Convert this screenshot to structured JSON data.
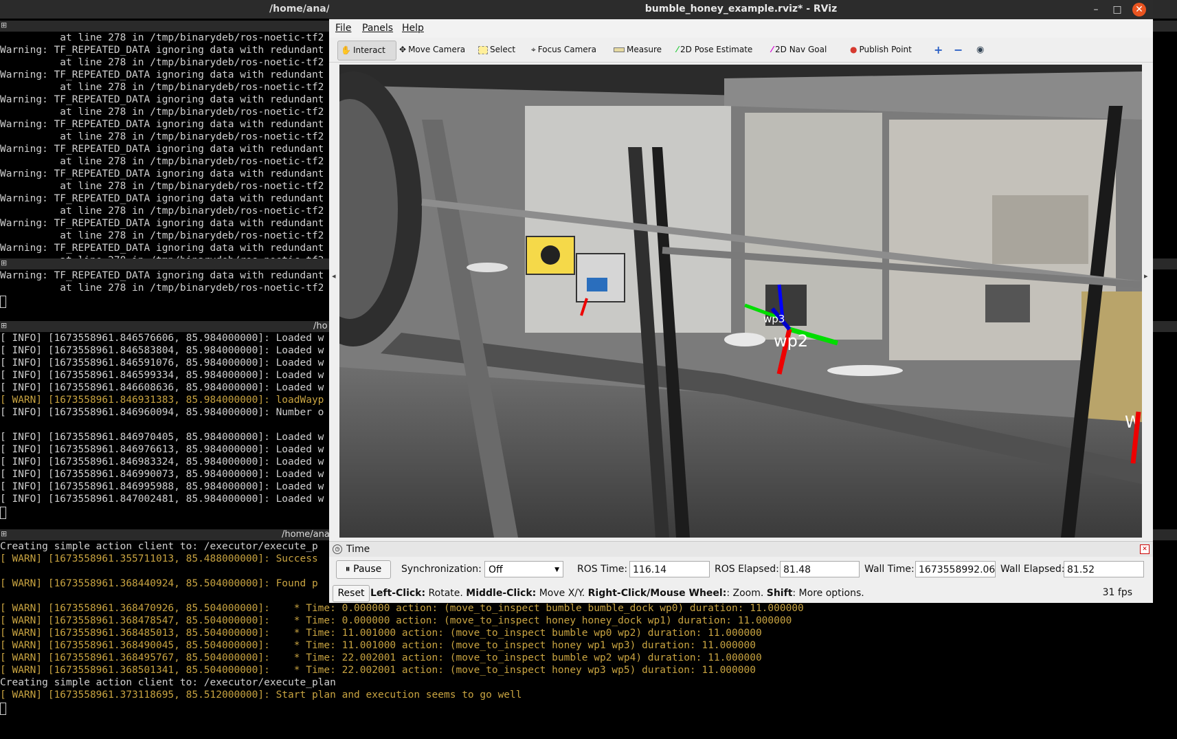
{
  "terminal": {
    "window_title": "/home/ana/",
    "pane1": {
      "lines": [
        {
          "text": "          at line 278 in /tmp/binarydeb/ros-noetic-tf2",
          "level": "plain"
        },
        {
          "text": "Warning: TF_REPEATED_DATA ignoring data with redundant",
          "level": "plain"
        },
        {
          "text": "          at line 278 in /tmp/binarydeb/ros-noetic-tf2",
          "level": "plain"
        },
        {
          "text": "Warning: TF_REPEATED_DATA ignoring data with redundant",
          "level": "plain"
        },
        {
          "text": "          at line 278 in /tmp/binarydeb/ros-noetic-tf2",
          "level": "plain"
        },
        {
          "text": "Warning: TF_REPEATED_DATA ignoring data with redundant",
          "level": "plain"
        },
        {
          "text": "          at line 278 in /tmp/binarydeb/ros-noetic-tf2",
          "level": "plain"
        },
        {
          "text": "Warning: TF_REPEATED_DATA ignoring data with redundant",
          "level": "plain"
        },
        {
          "text": "          at line 278 in /tmp/binarydeb/ros-noetic-tf2",
          "level": "plain"
        },
        {
          "text": "Warning: TF_REPEATED_DATA ignoring data with redundant",
          "level": "plain"
        },
        {
          "text": "          at line 278 in /tmp/binarydeb/ros-noetic-tf2",
          "level": "plain"
        },
        {
          "text": "Warning: TF_REPEATED_DATA ignoring data with redundant",
          "level": "plain"
        },
        {
          "text": "          at line 278 in /tmp/binarydeb/ros-noetic-tf2",
          "level": "plain"
        },
        {
          "text": "Warning: TF_REPEATED_DATA ignoring data with redundant",
          "level": "plain"
        },
        {
          "text": "          at line 278 in /tmp/binarydeb/ros-noetic-tf2",
          "level": "plain"
        },
        {
          "text": "Warning: TF_REPEATED_DATA ignoring data with redundant",
          "level": "plain"
        },
        {
          "text": "          at line 278 in /tmp/binarydeb/ros-noetic-tf2",
          "level": "plain"
        },
        {
          "text": "Warning: TF_REPEATED_DATA ignoring data with redundant",
          "level": "plain"
        },
        {
          "text": "          at line 278 in /tmp/binarydeb/ros-noetic-tf2",
          "level": "plain"
        }
      ]
    },
    "pane2": {
      "lines": [
        {
          "text": "Warning: TF_REPEATED_DATA ignoring data with redundant",
          "level": "plain"
        },
        {
          "text": "          at line 278 in /tmp/binarydeb/ros-noetic-tf2",
          "level": "plain"
        }
      ]
    },
    "pane3": {
      "title": "/ho",
      "lines": [
        {
          "text": "[ INFO] [1673558961.846576606, 85.984000000]: Loaded w",
          "level": "plain"
        },
        {
          "text": "[ INFO] [1673558961.846583804, 85.984000000]: Loaded w",
          "level": "plain"
        },
        {
          "text": "[ INFO] [1673558961.846591076, 85.984000000]: Loaded w",
          "level": "plain"
        },
        {
          "text": "[ INFO] [1673558961.846599334, 85.984000000]: Loaded w",
          "level": "plain"
        },
        {
          "text": "[ INFO] [1673558961.846608636, 85.984000000]: Loaded w",
          "level": "plain"
        },
        {
          "text": "[ WARN] [1673558961.846931383, 85.984000000]: loadWayp",
          "level": "warn"
        },
        {
          "text": "[ INFO] [1673558961.846960094, 85.984000000]: Number o",
          "level": "plain"
        },
        {
          "text": "",
          "level": "plain"
        },
        {
          "text": "[ INFO] [1673558961.846970405, 85.984000000]: Loaded w",
          "level": "plain"
        },
        {
          "text": "[ INFO] [1673558961.846976613, 85.984000000]: Loaded w",
          "level": "plain"
        },
        {
          "text": "[ INFO] [1673558961.846983324, 85.984000000]: Loaded w",
          "level": "plain"
        },
        {
          "text": "[ INFO] [1673558961.846990073, 85.984000000]: Loaded w",
          "level": "plain"
        },
        {
          "text": "[ INFO] [1673558961.846995988, 85.984000000]: Loaded w",
          "level": "plain"
        },
        {
          "text": "[ INFO] [1673558961.847002481, 85.984000000]: Loaded w",
          "level": "plain"
        }
      ]
    },
    "pane4": {
      "title": "/home/ana/",
      "lines": [
        {
          "text": "Creating simple action client to: /executor/execute_p",
          "level": "plain"
        },
        {
          "text": "[ WARN] [1673558961.355711013, 85.488000000]: Success",
          "level": "warn"
        },
        {
          "text": "",
          "level": "plain"
        },
        {
          "text": "[ WARN] [1673558961.368440924, 85.504000000]: Found p",
          "level": "warn"
        },
        {
          "text": "",
          "level": "plain"
        },
        {
          "text": "[ WARN] [1673558961.368470926, 85.504000000]:    * Time: 0.000000 action: (move_to_inspect bumble bumble_dock wp0) duration: 11.000000",
          "level": "warn"
        },
        {
          "text": "[ WARN] [1673558961.368478547, 85.504000000]:    * Time: 0.000000 action: (move_to_inspect honey honey_dock wp1) duration: 11.000000",
          "level": "warn"
        },
        {
          "text": "[ WARN] [1673558961.368485013, 85.504000000]:    * Time: 11.001000 action: (move_to_inspect bumble wp0 wp2) duration: 11.000000",
          "level": "warn"
        },
        {
          "text": "[ WARN] [1673558961.368490045, 85.504000000]:    * Time: 11.001000 action: (move_to_inspect honey wp1 wp3) duration: 11.000000",
          "level": "warn"
        },
        {
          "text": "[ WARN] [1673558961.368495767, 85.504000000]:    * Time: 22.002001 action: (move_to_inspect bumble wp2 wp4) duration: 11.000000",
          "level": "warn"
        },
        {
          "text": "[ WARN] [1673558961.368501341, 85.504000000]:    * Time: 22.002001 action: (move_to_inspect honey wp3 wp5) duration: 11.000000",
          "level": "warn"
        },
        {
          "text": "Creating simple action client to: /executor/execute_plan",
          "level": "plain"
        },
        {
          "text": "[ WARN] [1673558961.373118695, 85.512000000]: Start plan and execution seems to go well",
          "level": "warn"
        }
      ]
    }
  },
  "rviz": {
    "window_title": "bumble_honey_example.rviz* - RViz",
    "menu": [
      "File",
      "Panels",
      "Help"
    ],
    "tools": [
      {
        "label": "Interact",
        "icon": "hand-icon",
        "active": true
      },
      {
        "label": "Move Camera",
        "icon": "move-camera-icon"
      },
      {
        "label": "Select",
        "icon": "select-icon"
      },
      {
        "label": "Focus Camera",
        "icon": "focus-camera-icon"
      },
      {
        "label": "Measure",
        "icon": "measure-icon"
      },
      {
        "label": "2D Pose Estimate",
        "icon": "pose-estimate-icon",
        "color": "#2ecc40"
      },
      {
        "label": "2D Nav Goal",
        "icon": "nav-goal-icon",
        "color": "#d400d4"
      },
      {
        "label": "Publish Point",
        "icon": "map-pin-icon",
        "color": "#d63a2f"
      }
    ],
    "viewport": {
      "labels": {
        "wp2": "wp2",
        "wp3": "wp3",
        "wp_edge": "W"
      }
    },
    "time_panel": {
      "title": "Time",
      "pause_label": "Pause",
      "sync_label": "Synchronization:",
      "sync_value": "Off",
      "ros_time_label": "ROS Time:",
      "ros_time": "116.14",
      "ros_elapsed_label": "ROS Elapsed:",
      "ros_elapsed": "81.48",
      "wall_time_label": "Wall Time:",
      "wall_time": "1673558992.06",
      "wall_elapsed_label": "Wall Elapsed:",
      "wall_elapsed": "81.52"
    },
    "status": {
      "reset_label": "Reset",
      "left_click": "Left-Click:",
      "left_click_desc": " Rotate. ",
      "middle_click": "Middle-Click:",
      "middle_click_desc": " Move X/Y. ",
      "right_click": "Right-Click/Mouse Wheel:",
      "right_click_desc": ": Zoom. ",
      "shift": "Shift",
      "shift_desc": ": More options.",
      "fps": "31 fps"
    }
  }
}
